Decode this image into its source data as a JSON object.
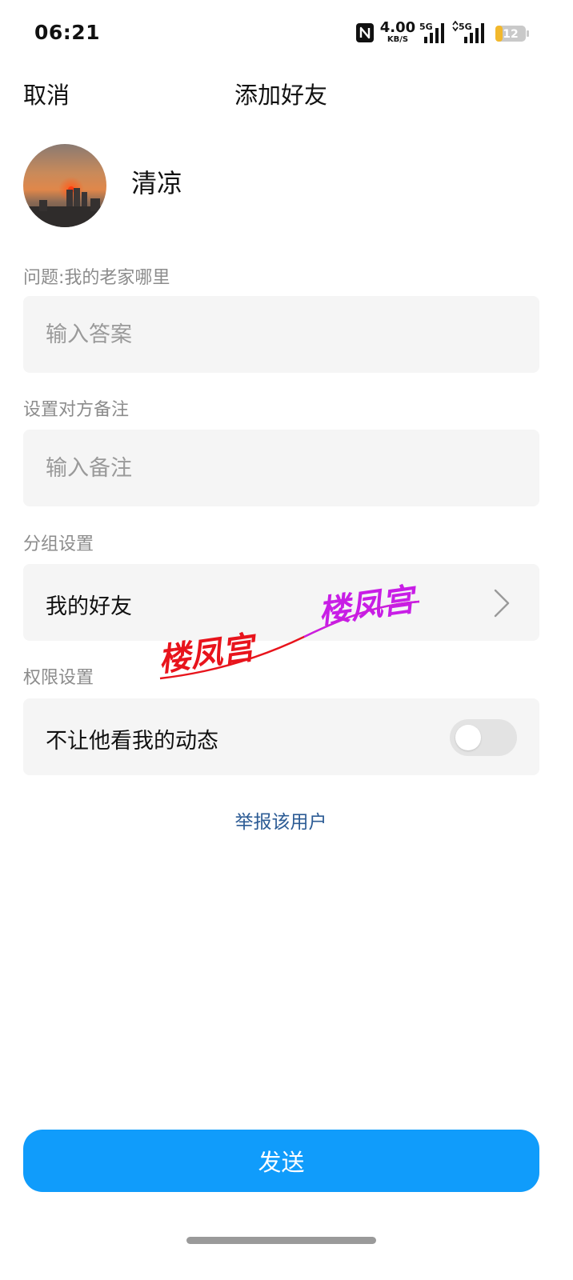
{
  "status_bar": {
    "time": "06:21",
    "net_speed": "4.00",
    "net_speed_unit": "KB/S",
    "signal1_label": "5G",
    "signal2_label": "5G",
    "battery_level": "12",
    "battery_color": "#f2b82c",
    "icons": [
      "nfc-icon",
      "signal-icon",
      "signal-icon",
      "battery-icon"
    ]
  },
  "nav": {
    "cancel_label": "取消",
    "title": "添加好友"
  },
  "profile": {
    "nickname": "清凉"
  },
  "question": {
    "label": "问题:我的老家哪里",
    "placeholder": "输入答案",
    "value": ""
  },
  "remark": {
    "label": "设置对方备注",
    "placeholder": "输入备注",
    "value": ""
  },
  "group": {
    "label": "分组设置",
    "selected": "我的好友"
  },
  "permission": {
    "label": "权限设置",
    "option_label": "不让他看我的动态",
    "enabled": false
  },
  "report_label": "举报该用户",
  "send_label": "发送",
  "watermark": {
    "text1": "楼凤宫",
    "text2": "楼凤宫"
  },
  "colors": {
    "accent": "#109cfb",
    "link": "#2d5c95",
    "watermark_red": "#e8141c",
    "watermark_purple": "#c81ee6"
  }
}
